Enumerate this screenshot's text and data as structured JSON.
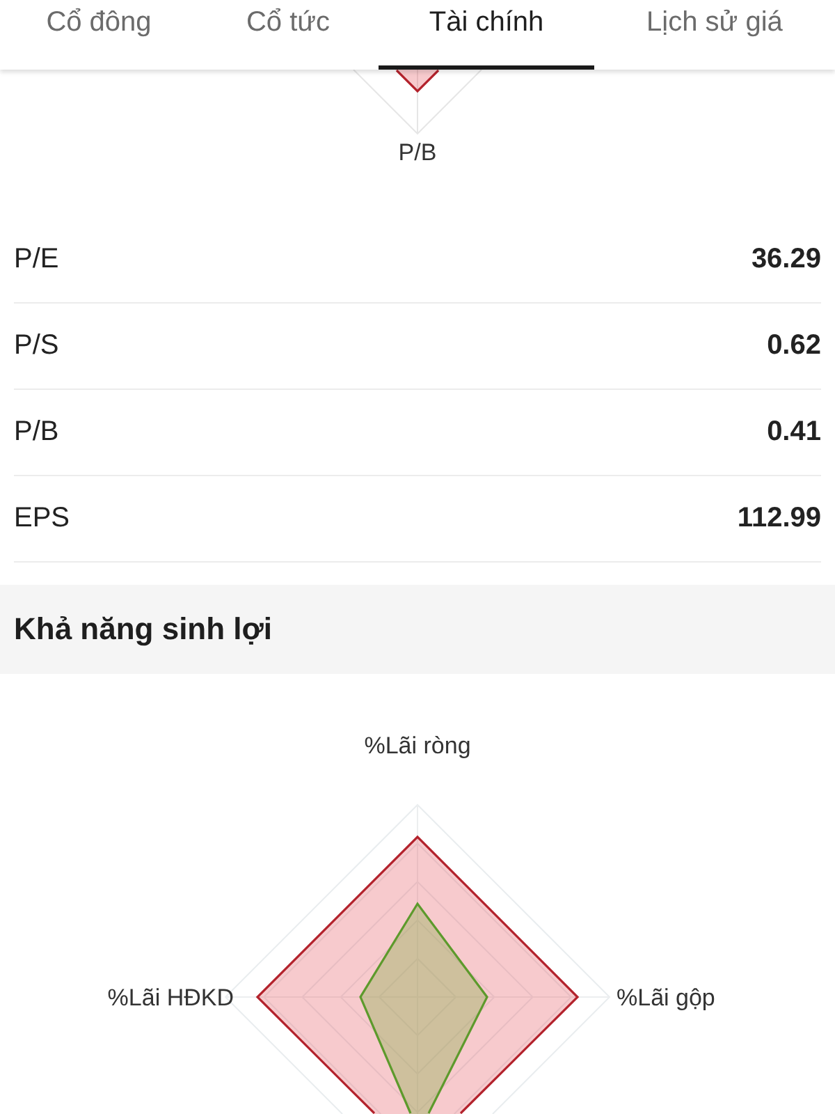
{
  "tabs": [
    {
      "label": "Cổ đông",
      "selected": false
    },
    {
      "label": "Cổ tức",
      "selected": false
    },
    {
      "label": "Tài chính",
      "selected": true
    },
    {
      "label": "Lịch sử giá",
      "selected": false
    }
  ],
  "valuation_chart": {
    "axis_label": "P/B"
  },
  "metrics": [
    {
      "label": "P/E",
      "value": "36.29"
    },
    {
      "label": "P/S",
      "value": "0.62"
    },
    {
      "label": "P/B",
      "value": "0.41"
    },
    {
      "label": "EPS",
      "value": "112.99"
    }
  ],
  "profitability": {
    "title": "Khả năng sinh lợi",
    "radar_chart": {
      "axis_labels": [
        "%Lãi ròng",
        "%Lãi gộp",
        "%Lãi HĐKD"
      ]
    }
  }
}
